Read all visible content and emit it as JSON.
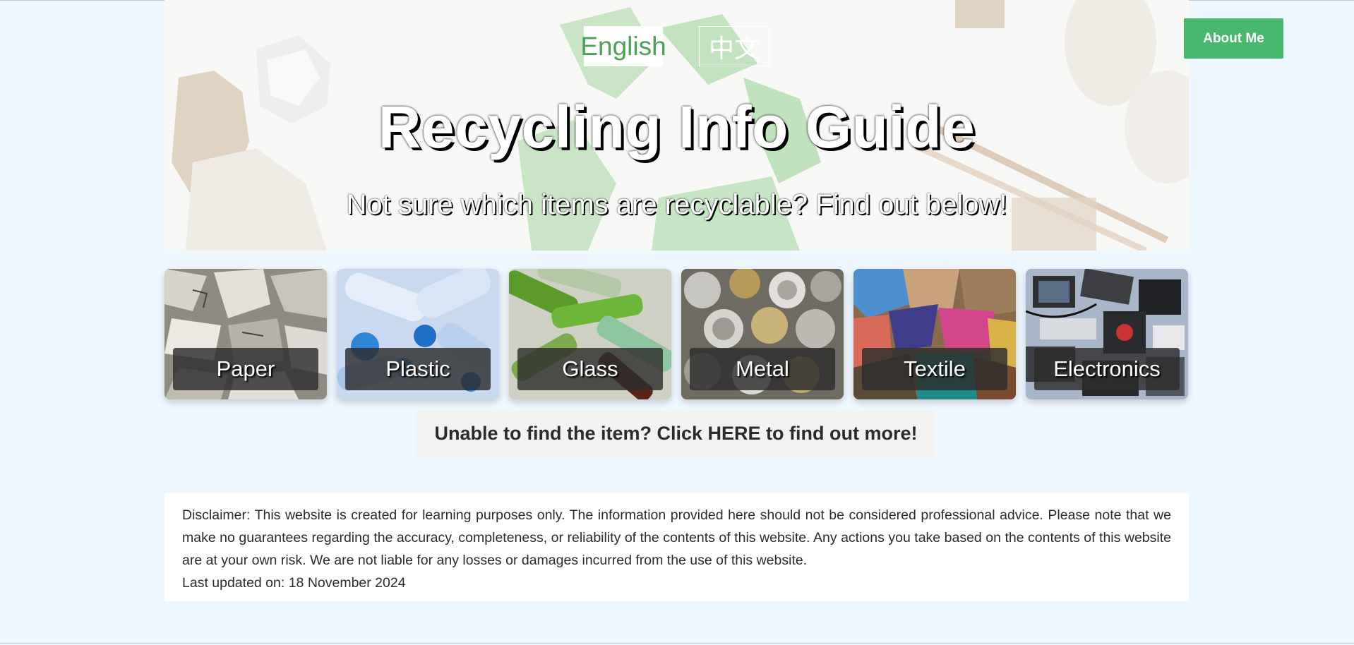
{
  "hero": {
    "title": "Recycling Info Guide",
    "subtitle": "Not sure which items are recyclable? Find out below!",
    "languages": {
      "english": "English",
      "chinese": "中文"
    }
  },
  "nav": {
    "about_label": "About Me"
  },
  "categories": [
    {
      "label": "Paper"
    },
    {
      "label": "Plastic"
    },
    {
      "label": "Glass"
    },
    {
      "label": "Metal"
    },
    {
      "label": "Textile"
    },
    {
      "label": "Electronics"
    }
  ],
  "more_link": {
    "label": "Unable to find the item? Click HERE to find out more!"
  },
  "disclaimer": {
    "text": "Disclaimer: This website is created for learning purposes only. The information provided here should not be considered professional advice. Please note that we make no guarantees regarding the accuracy, completeness, or reliability of the contents of this website. Any actions you take based on the contents of this website are at your own risk. We are not liable for any losses or damages incurred from the use of this website.",
    "last_updated": "Last updated on: 18 November 2024"
  },
  "colors": {
    "page_background": "#eef6fe",
    "accent_green": "#47b86d",
    "english_text_green": "#4aa157"
  }
}
